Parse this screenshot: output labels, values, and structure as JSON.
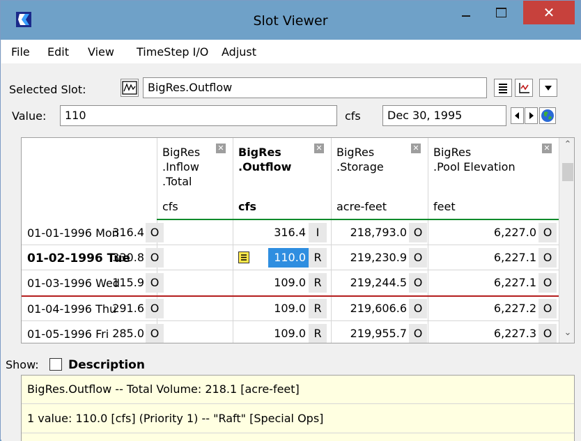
{
  "window": {
    "title": "Slot Viewer"
  },
  "menu": [
    "File",
    "Edit",
    "View",
    "TimeStep I/O",
    "Adjust"
  ],
  "selected_slot": {
    "label": "Selected Slot:",
    "value": "BigRes.Outflow"
  },
  "value_row": {
    "label": "Value:",
    "value": "110",
    "unit": "cfs",
    "date": "Dec 30, 1995"
  },
  "columns": [
    {
      "lines": [
        "BigRes",
        ".Inflow",
        ".Total"
      ],
      "unit": "cfs",
      "bold": false
    },
    {
      "lines": [
        "BigRes",
        ".Outflow"
      ],
      "unit": "cfs",
      "bold": true
    },
    {
      "lines": [
        "BigRes",
        ".Storage"
      ],
      "unit": "acre-feet",
      "bold": false
    },
    {
      "lines": [
        "BigRes",
        ".Pool Elevation"
      ],
      "unit": "feet",
      "bold": false
    }
  ],
  "rows": [
    {
      "date": "01-01-1996 Mon",
      "bold": false,
      "vals": [
        "316.4",
        "316.4",
        "218,793.0",
        "6,227.0"
      ],
      "flags": [
        "O",
        "I",
        "O",
        "O"
      ]
    },
    {
      "date": "01-02-1996 Tue",
      "bold": true,
      "vals": [
        "330.8",
        "110.0",
        "219,230.9",
        "6,227.1"
      ],
      "flags": [
        "O",
        "R",
        "O",
        "O"
      ]
    },
    {
      "date": "01-03-1996 Wed",
      "bold": false,
      "vals": [
        "115.9",
        "109.0",
        "219,244.5",
        "6,227.1"
      ],
      "flags": [
        "O",
        "R",
        "O",
        "O"
      ]
    },
    {
      "date": "01-04-1996 Thu",
      "bold": false,
      "vals": [
        "291.6",
        "109.0",
        "219,606.6",
        "6,227.2"
      ],
      "flags": [
        "O",
        "R",
        "O",
        "O"
      ]
    },
    {
      "date": "01-05-1996 Fri",
      "bold": false,
      "vals": [
        "285.0",
        "109.0",
        "219,955.7",
        "6,227.3"
      ],
      "flags": [
        "O",
        "R",
        "O",
        "O"
      ]
    }
  ],
  "show": {
    "label": "Show:",
    "checkbox_label": "Description",
    "checked": false
  },
  "description": [
    "BigRes.Outflow -- Total Volume: 218.1 [acre-feet]",
    "1 value:  110.0 [cfs]  (Priority 1) -- \"Raft\" [Special Ops]"
  ],
  "colors": {
    "titlebar": "#6fa1c8",
    "close": "#c7413c",
    "selection": "#2f8ee0",
    "header_line": "#0f8a2a",
    "timestep_line": "#b41c1c",
    "desc_bg": "#ffffe1"
  }
}
